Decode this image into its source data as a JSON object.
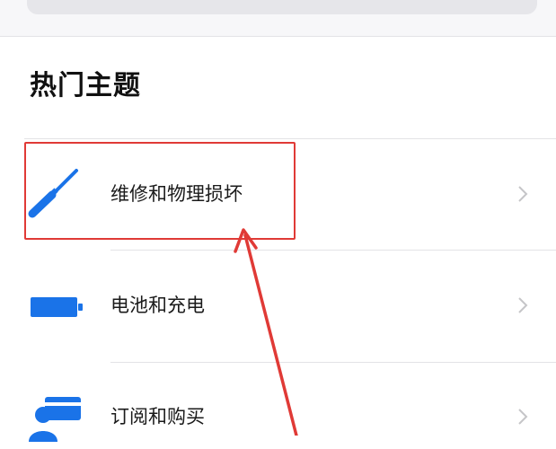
{
  "search": {
    "bar": ""
  },
  "section": {
    "title": "热门主题"
  },
  "topics": [
    {
      "label": "维修和物理损坏",
      "icon": "screwdriver-icon"
    },
    {
      "label": "电池和充电",
      "icon": "battery-icon"
    },
    {
      "label": "订阅和购买",
      "icon": "person-card-icon"
    }
  ],
  "colors": {
    "accent_blue": "#1a73e8",
    "annotation_red": "#e03a36",
    "chevron_gray": "#c5c5c8"
  }
}
